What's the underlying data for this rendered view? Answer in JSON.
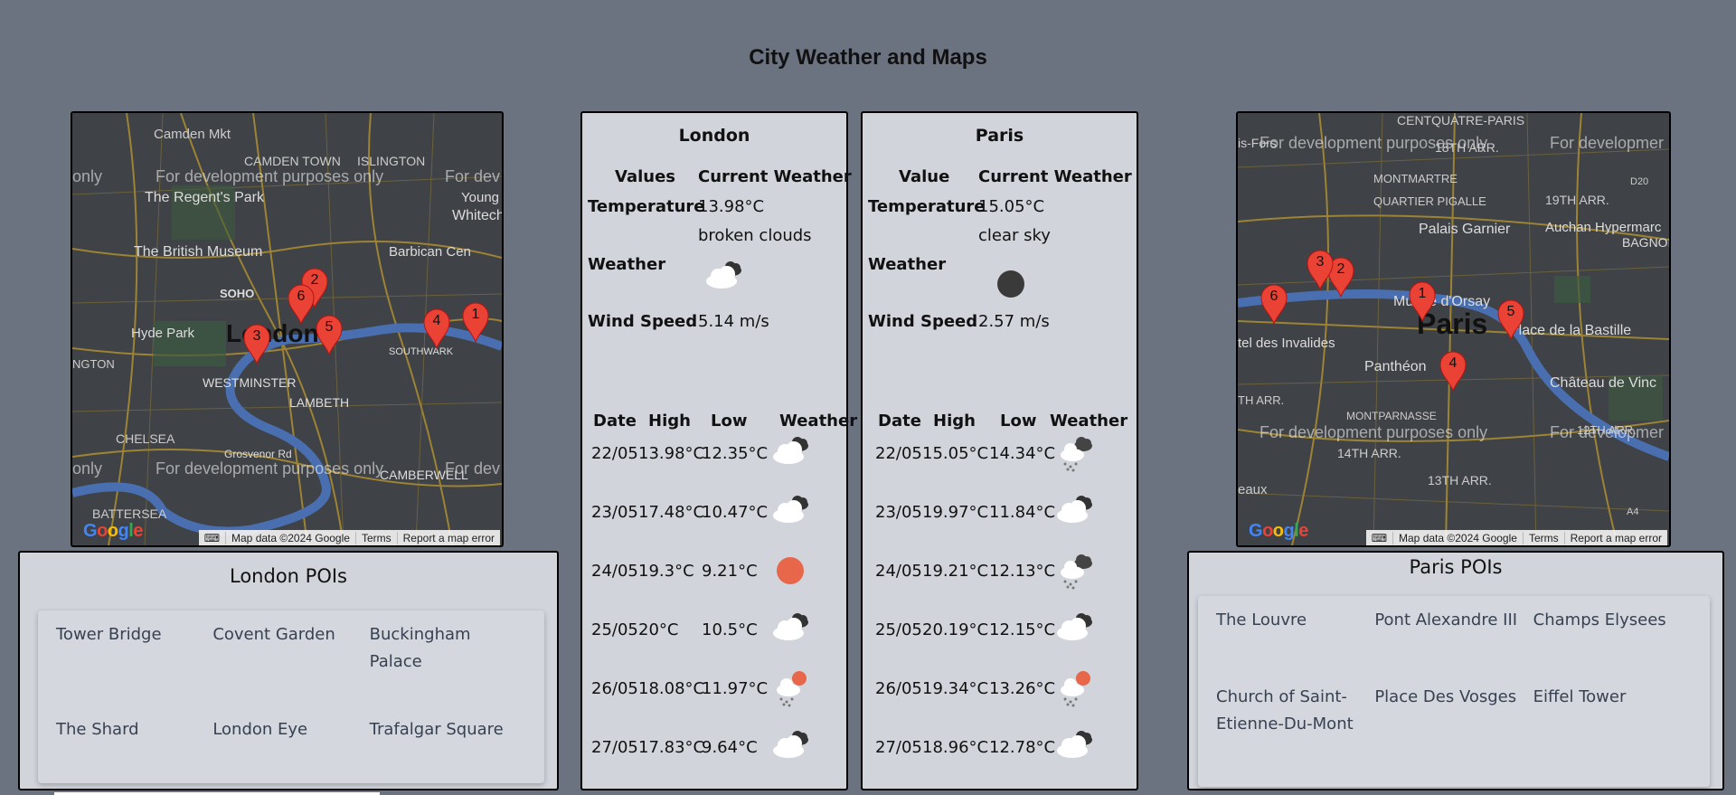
{
  "page": {
    "title": "City Weather and Maps"
  },
  "maps": {
    "london": {
      "labels": [
        "Camden Mkt",
        "CAMDEN TOWN",
        "ISLINGTON",
        "The Regent's Park",
        "Whitech",
        "The British Museum",
        "Barbican Cen",
        "SOHO",
        "Hyde Park",
        "London",
        "NGTON",
        "WESTMINSTER",
        "LAMBETH",
        "SOUTHWARK",
        "CHELSEA",
        "Grosvenor Rd",
        "BATTERSEA",
        "CAMBERWELL",
        "Young V&"
      ],
      "dev_text": "For development purposes only",
      "dev_text_short": "For dev",
      "only": "only",
      "markers": [
        "1",
        "2",
        "3",
        "4",
        "5",
        "6"
      ],
      "credits": {
        "data": "Map data ©2024 Google",
        "terms": "Terms",
        "report": "Report a map error"
      },
      "logo": "Google"
    },
    "paris": {
      "labels": [
        "CENTQUATRE-PARIS",
        "is-Fors",
        "18TH ARR.",
        "19TH ARR.",
        "MONTMARTRE",
        "QUARTIER PIGALLE",
        "Palais Garnier",
        "Auchan Hypermarc",
        "BAGNOL",
        "Musée d'Orsay",
        "Paris",
        "Place de la Bastille",
        "tel des Invalides",
        "Panthéon",
        "Château de Vinc",
        "TH ARR.",
        "MONTPARNASSE",
        "14TH ARR.",
        "13TH ARR.",
        "12TH ARR.",
        "eaux",
        "D20",
        "A4"
      ],
      "dev_text": "For development purposes only",
      "dev_text_short": "For developmer",
      "markers": [
        "1",
        "2",
        "3",
        "4",
        "5",
        "6"
      ],
      "credits": {
        "data": "Map data ©2024 Google",
        "terms": "Terms",
        "report": "Report a map error"
      },
      "logo": "Google"
    }
  },
  "london_pois": {
    "title": "London POIs",
    "items": [
      "Tower Bridge",
      "Covent Garden",
      "Buckingham Palace",
      "The Shard",
      "London Eye",
      "Trafalgar Square"
    ]
  },
  "paris_pois": {
    "title": "Paris POIs",
    "items": [
      "The Louvre",
      "Pont Alexandre III",
      "Champs Elysees",
      "Church of Saint-Etienne-Du-Mont",
      "Place Des Vosges",
      "Eiffel Tower"
    ]
  },
  "weather": {
    "london": {
      "city": "London",
      "col_values": "Values",
      "col_current": "Current Weather",
      "temp_label": "Temperature",
      "temp": "13.98°C",
      "desc": "broken clouds",
      "weather_label": "Weather",
      "current_icon": "broken-clouds-icon",
      "wind_label": "Wind Speed",
      "wind": "5.14 m/s",
      "forecast_headers": {
        "date": "Date",
        "high": "High",
        "low": "Low",
        "weather": "Weather"
      },
      "forecast": [
        {
          "date": "22/05",
          "high": "13.98°C",
          "low": "12.35°C",
          "icon": "broken-clouds-icon"
        },
        {
          "date": "23/05",
          "high": "17.48°C",
          "low": "10.47°C",
          "icon": "broken-clouds-icon"
        },
        {
          "date": "24/05",
          "high": "19.3°C",
          "low": "9.21°C",
          "icon": "sun-icon"
        },
        {
          "date": "25/05",
          "high": "20°C",
          "low": "10.5°C",
          "icon": "broken-clouds-icon"
        },
        {
          "date": "26/05",
          "high": "18.08°C",
          "low": "11.97°C",
          "icon": "rain-sun-icon"
        },
        {
          "date": "27/05",
          "high": "17.83°C",
          "low": "9.64°C",
          "icon": "broken-clouds-icon"
        }
      ]
    },
    "paris": {
      "city": "Paris",
      "col_values": "Value",
      "col_current": "Current Weather",
      "temp_label": "Temperature",
      "temp": "15.05°C",
      "desc": "clear sky",
      "weather_label": "Weather",
      "current_icon": "clear-night-icon",
      "wind_label": "Wind Speed",
      "wind": "2.57 m/s",
      "forecast_headers": {
        "date": "Date",
        "high": "High",
        "low": "Low",
        "weather": "Weather"
      },
      "forecast": [
        {
          "date": "22/05",
          "high": "15.05°C",
          "low": "14.34°C",
          "icon": "rain-cloud-icon"
        },
        {
          "date": "23/05",
          "high": "19.97°C",
          "low": "11.84°C",
          "icon": "broken-clouds-icon"
        },
        {
          "date": "24/05",
          "high": "19.21°C",
          "low": "12.13°C",
          "icon": "rain-cloud-icon"
        },
        {
          "date": "25/05",
          "high": "20.19°C",
          "low": "12.15°C",
          "icon": "broken-clouds-icon"
        },
        {
          "date": "26/05",
          "high": "19.34°C",
          "low": "13.26°C",
          "icon": "rain-sun-icon"
        },
        {
          "date": "27/05",
          "high": "18.96°C",
          "low": "12.78°C",
          "icon": "broken-clouds-icon"
        }
      ]
    }
  },
  "colors": {
    "background": "#6b7280",
    "panel": "#d1d5db",
    "marker": "#ea4335",
    "sun": "#e8664a"
  }
}
